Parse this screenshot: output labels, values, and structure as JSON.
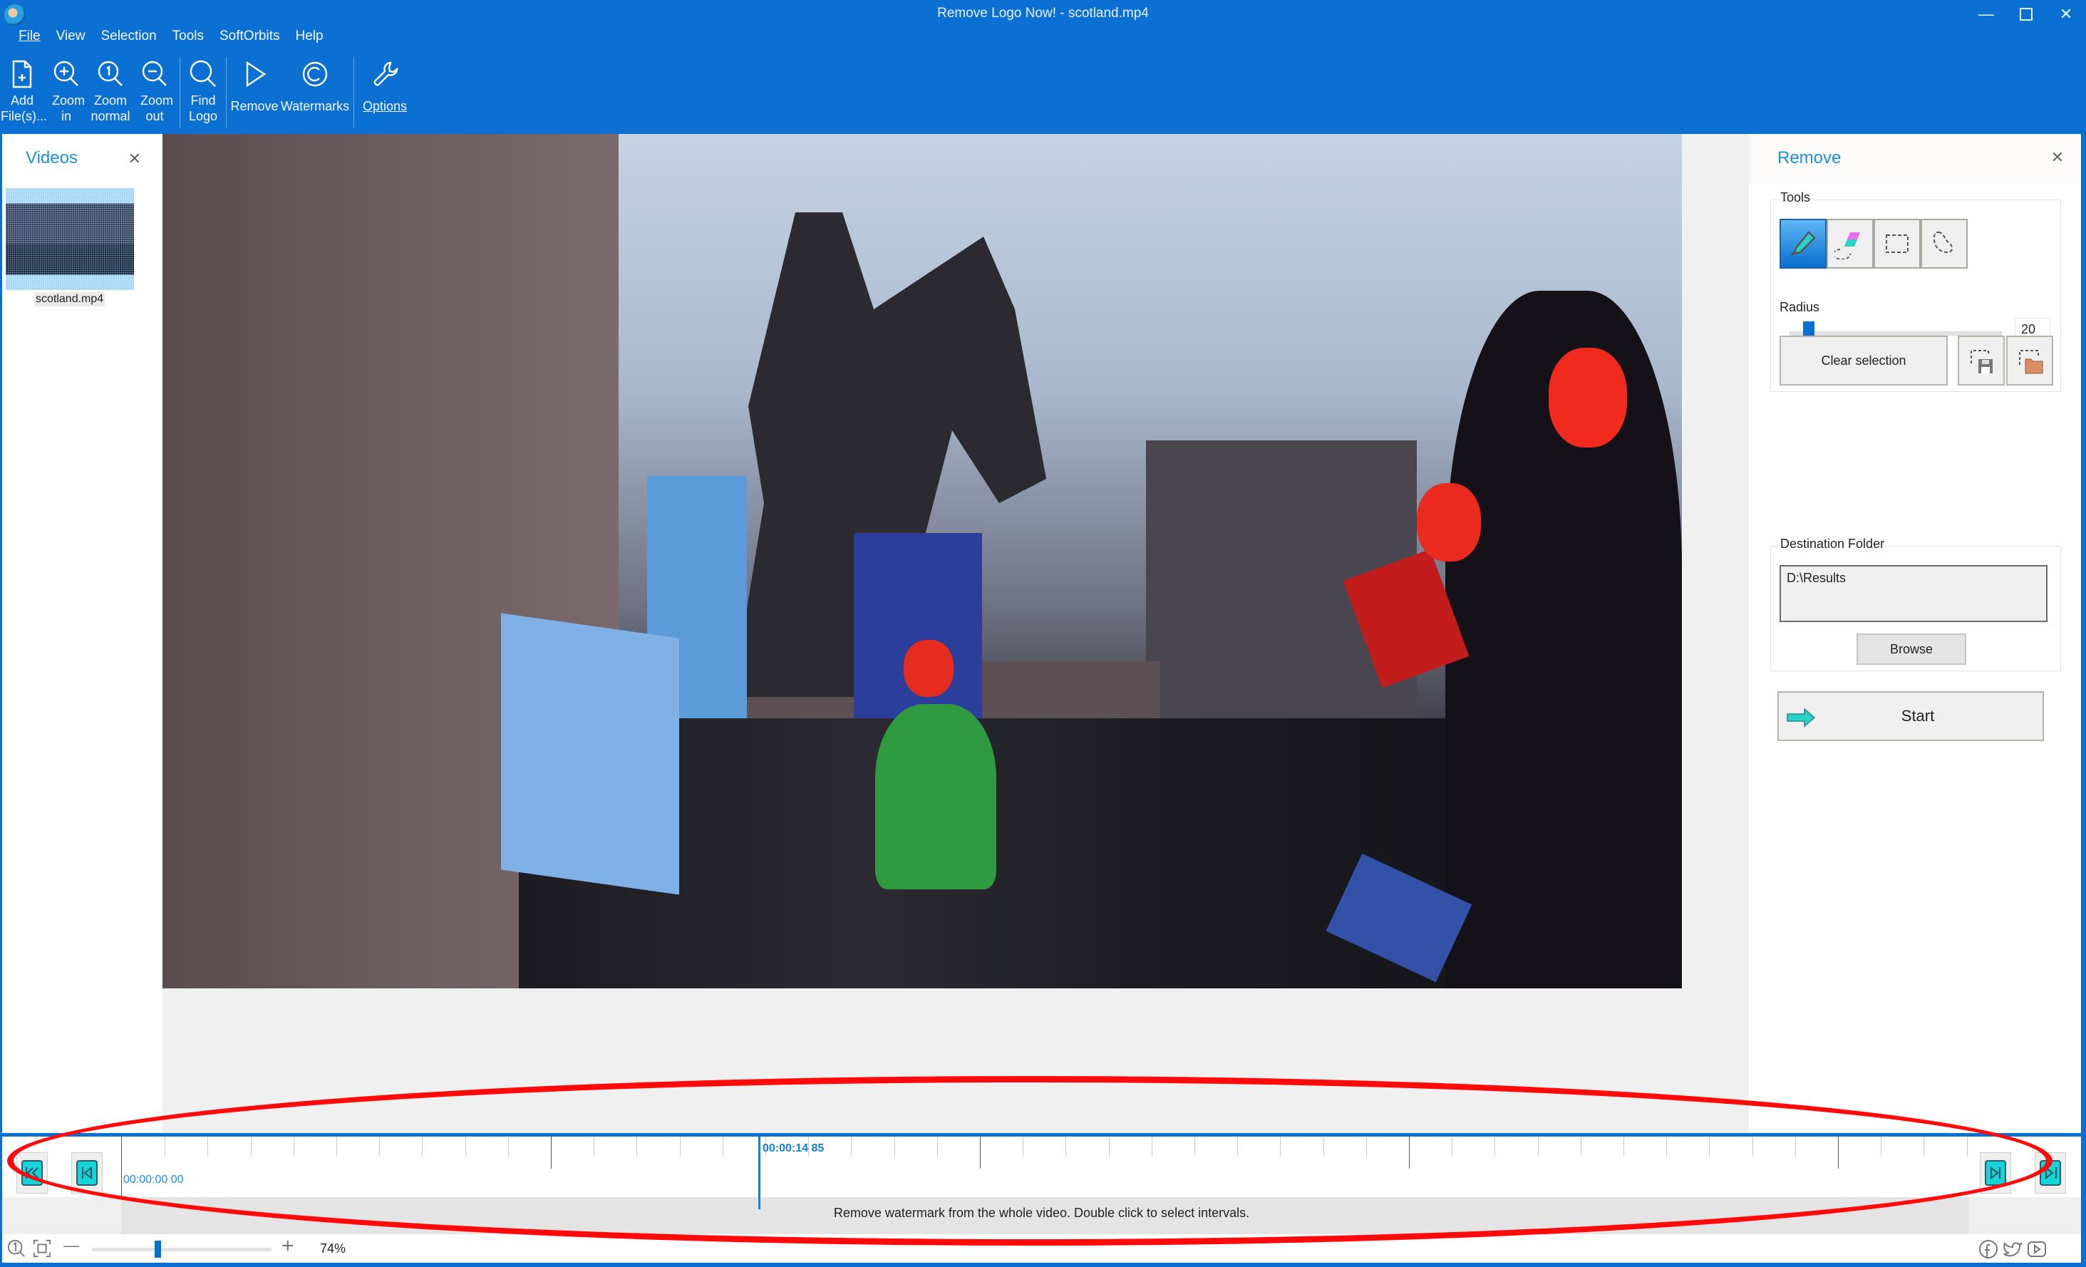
{
  "window": {
    "title": "Remove Logo Now! - scotland.mp4",
    "controls": [
      "minimize",
      "maximize",
      "close"
    ]
  },
  "menu": [
    {
      "label": "File",
      "accel": "F"
    },
    {
      "label": "View",
      "accel": "V"
    },
    {
      "label": "Selection",
      "accel": "S"
    },
    {
      "label": "Tools",
      "accel": "T"
    },
    {
      "label": "SoftOrbits",
      "accel": ""
    },
    {
      "label": "Help",
      "accel": "H"
    }
  ],
  "toolbar": {
    "add_files": "Add File(s)...",
    "zoom_in": "Zoom in",
    "zoom_normal": "Zoom normal",
    "zoom_out": "Zoom out",
    "find_logo": "Find Logo",
    "remove": "Remove",
    "watermarks": "Watermarks",
    "options": "Options"
  },
  "videos_panel": {
    "title": "Videos",
    "items": [
      {
        "name": "scotland.mp4",
        "selected": true
      }
    ]
  },
  "remove_panel": {
    "title": "Remove",
    "tools_label": "Tools",
    "tools": [
      {
        "name": "marker",
        "active": true
      },
      {
        "name": "eraser",
        "active": false
      },
      {
        "name": "rectangle-select",
        "active": false
      },
      {
        "name": "lasso-select",
        "active": false
      }
    ],
    "radius_label": "Radius",
    "radius_value": "20",
    "radius_fraction": 0.06,
    "clear_selection": "Clear selection",
    "destination_label": "Destination Folder",
    "destination_value": "D:\\Results",
    "browse": "Browse",
    "start": "Start"
  },
  "timeline": {
    "start_time": "00:00:00 00",
    "current_time": "00:00:14 85",
    "hint": "Remove watermark from the whole video. Double click to select intervals."
  },
  "statusbar": {
    "zoom_percent": "74%",
    "zoom_fraction": 0.35,
    "social": [
      "facebook",
      "twitter",
      "youtube"
    ]
  },
  "colors": {
    "accent": "#0b70d1",
    "panel_title": "#1e90d8",
    "nav_button": "#16d5d8",
    "annotation": "#ff0a0a"
  }
}
